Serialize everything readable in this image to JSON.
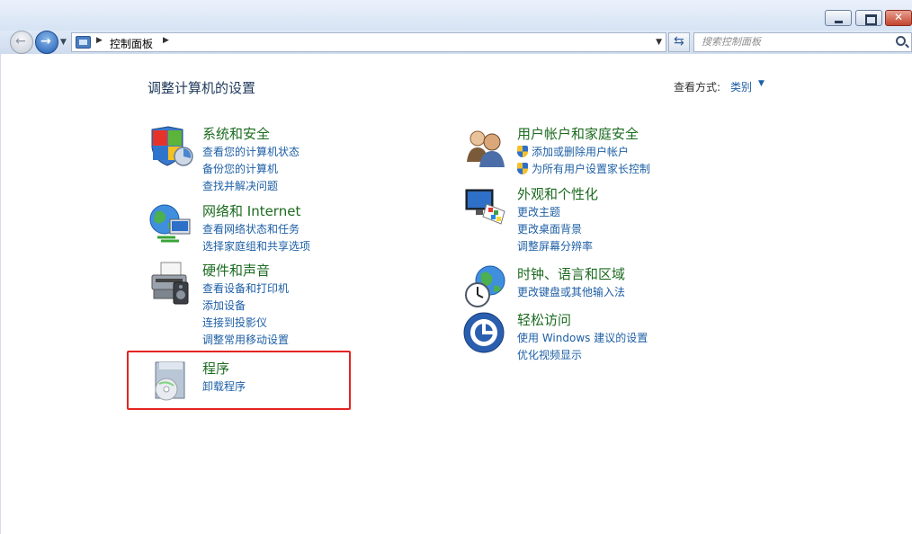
{
  "window": {
    "buttons": [
      "minimize",
      "maximize",
      "close"
    ]
  },
  "navbar": {
    "back_icon": "back-arrow-icon",
    "forward_icon": "forward-arrow-icon",
    "address": {
      "crumb": "控制面板"
    },
    "search_placeholder": "搜索控制面板"
  },
  "content": {
    "title": "调整计算机的设置",
    "view_by": {
      "label": "查看方式:",
      "value": "类别"
    },
    "categories": [
      {
        "title": "系统和安全",
        "icon": "system-security-shield-icon",
        "links": [
          "查看您的计算机状态",
          "备份您的计算机",
          "查找并解决问题"
        ]
      },
      {
        "title": "网络和 Internet",
        "icon": "network-globe-icon",
        "links": [
          "查看网络状态和任务",
          "选择家庭组和共享选项"
        ]
      },
      {
        "title": "硬件和声音",
        "icon": "printer-speaker-icon",
        "links": [
          "查看设备和打印机",
          "添加设备",
          "连接到投影仪",
          "调整常用移动设置"
        ]
      },
      {
        "title": "程序",
        "icon": "programs-disc-icon",
        "links": [
          "卸载程序"
        ]
      },
      {
        "title": "用户帐户和家庭安全",
        "icon": "users-icon",
        "links": [
          "添加或删除用户帐户",
          "为所有用户设置家长控制"
        ]
      },
      {
        "title": "外观和个性化",
        "icon": "monitor-palette-icon",
        "links": [
          "更改主题",
          "更改桌面背景",
          "调整屏幕分辨率"
        ]
      },
      {
        "title": "时钟、语言和区域",
        "icon": "clock-globe-icon",
        "links": [
          "更改键盘或其他输入法"
        ]
      },
      {
        "title": "轻松访问",
        "icon": "ease-of-access-icon",
        "links": [
          "使用 Windows 建议的设置",
          "优化视频显示"
        ]
      }
    ]
  },
  "colors": {
    "category_title": "#1c6b20",
    "link": "#1e5fa5",
    "highlight_border": "#e52323"
  }
}
